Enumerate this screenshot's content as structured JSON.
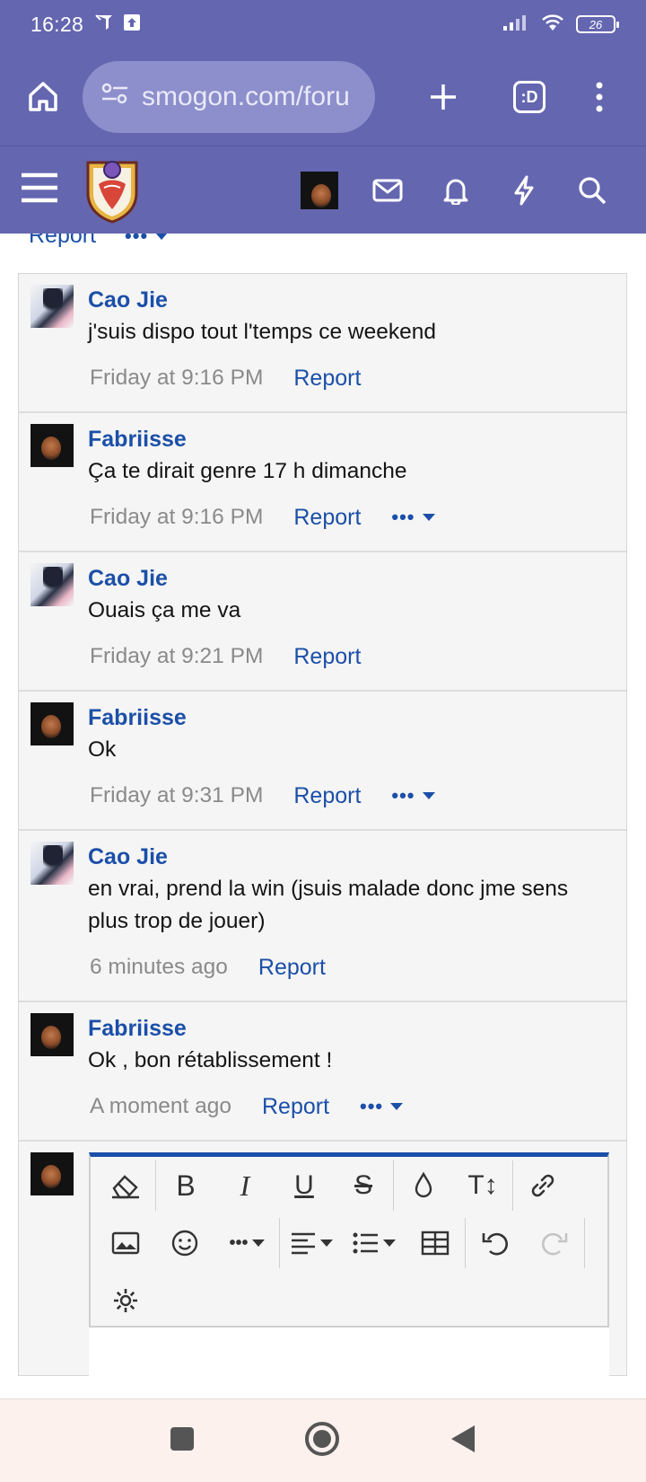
{
  "status_bar": {
    "time": "16:28",
    "battery": "26",
    "icons": [
      "mute-icon",
      "upload-icon",
      "signal-icon",
      "wifi-icon",
      "battery-icon"
    ]
  },
  "browser": {
    "url": "smogon.com/foru",
    "tab_count": ":D",
    "icons": [
      "home-icon",
      "site-settings-icon",
      "new-tab-icon",
      "tab-switcher-icon",
      "overflow-menu-icon"
    ]
  },
  "site_nav": {
    "icons": [
      "hamburger-menu-icon",
      "smogon-logo",
      "user-avatar",
      "inbox-icon",
      "bell-icon",
      "lightning-icon",
      "search-icon"
    ]
  },
  "previous_post": {
    "report_label": "Report"
  },
  "messages": [
    {
      "author": "Cao Jie",
      "text": "j'suis dispo tout l'temps ce weekend",
      "time": "Friday at 9:16 PM",
      "report_label": "Report",
      "has_menu": false
    },
    {
      "author": "Fabriisse",
      "text": "Ça te dirait genre 17 h dimanche",
      "time": "Friday at 9:16 PM",
      "report_label": "Report",
      "has_menu": true
    },
    {
      "author": "Cao Jie",
      "text": "Ouais ça me va",
      "time": "Friday at 9:21 PM",
      "report_label": "Report",
      "has_menu": false
    },
    {
      "author": "Fabriisse",
      "text": "Ok",
      "time": "Friday at 9:31 PM",
      "report_label": "Report",
      "has_menu": true
    },
    {
      "author": "Cao Jie",
      "text": "en vrai, prend la win (jsuis malade donc jme sens plus trop de jouer)",
      "time": "6 minutes ago",
      "report_label": "Report",
      "has_menu": false
    },
    {
      "author": "Fabriisse",
      "text": "Ok , bon rétablissement !",
      "time": "A moment ago",
      "report_label": "Report",
      "has_menu": true
    }
  ],
  "editor": {
    "toolbar_row1": [
      "eraser-icon",
      "bold-icon",
      "italic-icon",
      "underline-icon",
      "strikethrough-icon",
      "color-icon",
      "text-size-icon",
      "link-icon"
    ],
    "toolbar_row2": [
      "image-icon",
      "emoji-icon",
      "more-options-icon",
      "align-icon",
      "list-icon",
      "table-icon",
      "undo-icon",
      "redo-icon"
    ],
    "toolbar_row3": [
      "settings-icon"
    ]
  },
  "colors": {
    "header": "#6466b0",
    "url_box": "#8d8fcc",
    "link": "#1b4fa8",
    "meta": "#8a8a8a",
    "post_bg": "#f5f5f5"
  }
}
